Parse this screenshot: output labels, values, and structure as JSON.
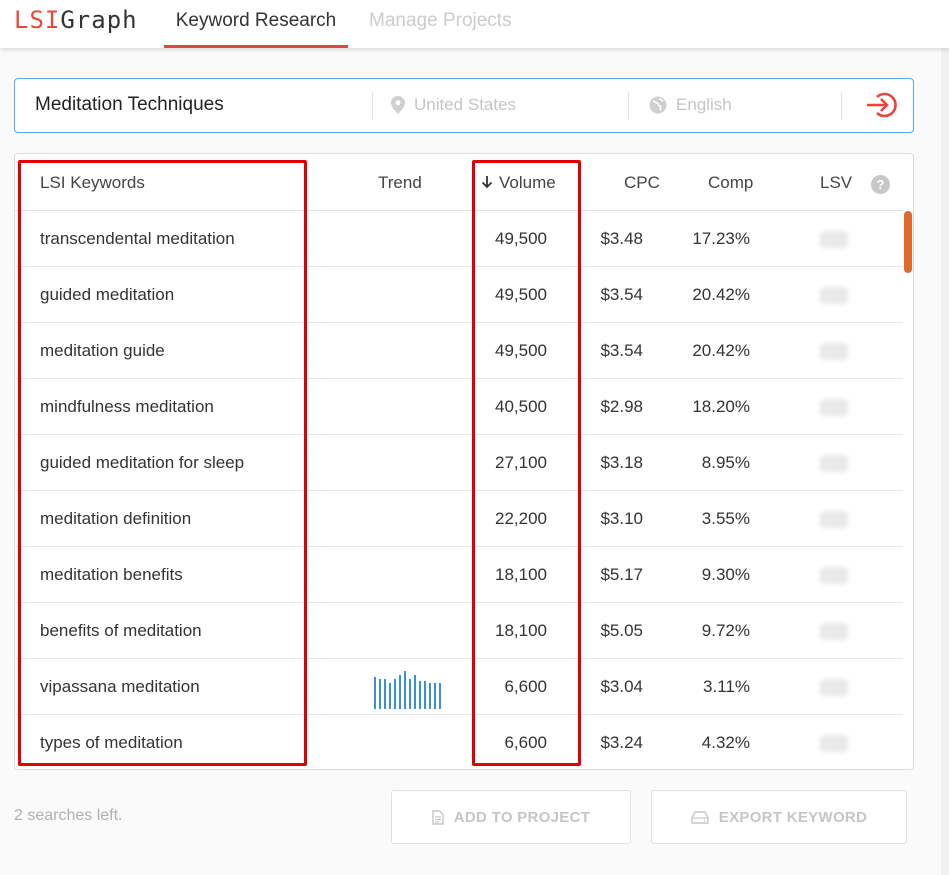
{
  "header": {
    "logo_lsi": "LSI",
    "logo_graph": "Graph",
    "tabs": [
      {
        "label": "Keyword Research",
        "active": true
      },
      {
        "label": "Manage Projects",
        "active": false
      }
    ]
  },
  "search": {
    "keyword": "Meditation Techniques",
    "location": "United States",
    "language": "English",
    "location_icon": "location-pin-icon",
    "language_icon": "globe-icon",
    "submit_icon": "arrow-into-circle-icon"
  },
  "table": {
    "columns": {
      "keyword": "LSI Keywords",
      "trend": "Trend",
      "volume": "Volume",
      "cpc": "CPC",
      "comp": "Comp",
      "lsv": "LSV"
    },
    "sort": {
      "column": "Volume",
      "direction": "descending",
      "icon": "arrow-down-icon"
    },
    "help_icon": "?",
    "rows": [
      {
        "keyword": "transcendental meditation",
        "volume": "49,500",
        "cpc": "$3.48",
        "comp": "17.23%"
      },
      {
        "keyword": "guided meditation",
        "volume": "49,500",
        "cpc": "$3.54",
        "comp": "20.42%"
      },
      {
        "keyword": "meditation guide",
        "volume": "49,500",
        "cpc": "$3.54",
        "comp": "20.42%"
      },
      {
        "keyword": "mindfulness meditation",
        "volume": "40,500",
        "cpc": "$2.98",
        "comp": "18.20%"
      },
      {
        "keyword": "guided meditation for sleep",
        "volume": "27,100",
        "cpc": "$3.18",
        "comp": "8.95%"
      },
      {
        "keyword": "meditation definition",
        "volume": "22,200",
        "cpc": "$3.10",
        "comp": "3.55%"
      },
      {
        "keyword": "meditation benefits",
        "volume": "18,100",
        "cpc": "$5.17",
        "comp": "9.30%"
      },
      {
        "keyword": "benefits of meditation",
        "volume": "18,100",
        "cpc": "$5.05",
        "comp": "9.72%"
      },
      {
        "keyword": "vipassana meditation",
        "volume": "6,600",
        "cpc": "$3.04",
        "comp": "3.11%",
        "has_trend": true
      },
      {
        "keyword": "types of meditation",
        "volume": "6,600",
        "cpc": "$3.24",
        "comp": "4.32%"
      }
    ]
  },
  "footer": {
    "searches_left": "2 searches left.",
    "add_to_project": "ADD TO PROJECT",
    "export_keyword": "EXPORT KEYWORD",
    "add_icon": "document-icon",
    "export_icon": "drive-icon"
  },
  "colors": {
    "brand_red": "#e84a3a",
    "tab_underline": "#e3453c",
    "search_border": "#5aa7e6",
    "trend_blue": "#3b8fd6",
    "scroll_thumb": "#e06a2c",
    "highlight_red": "#e00000"
  }
}
